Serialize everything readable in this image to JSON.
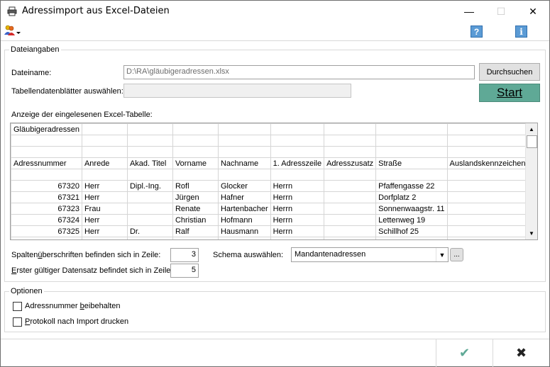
{
  "window": {
    "title": "Adressimport aus Excel-Dateien",
    "minimize": "—",
    "maximize": "☐",
    "close": "✕"
  },
  "toolbar": {
    "people_icon": "people-menu-icon",
    "help_icon": "?",
    "info_icon": "i"
  },
  "dateiangaben": {
    "legend": "Dateiangaben",
    "dateiname_label": "Dateiname:",
    "dateiname_value": "D:\\RA\\gläubigeradressen.xlsx",
    "durchsuchen": "Durchsuchen",
    "tabellenblaetter_label": "Tabellendatenblätter auswählen:",
    "tabellenblaetter_value": "",
    "start": "Start",
    "anzeige_label": "Anzeige der eingelesenen Excel-Tabelle:",
    "grid": {
      "rows": [
        [
          "Gläubigeradressen",
          "",
          "",
          "",
          "",
          "",
          "",
          "",
          ""
        ],
        [
          "",
          "",
          "",
          "",
          "",
          "",
          "",
          "",
          ""
        ],
        [
          "",
          "",
          "",
          "",
          "",
          "",
          "",
          "",
          ""
        ],
        [
          "Adressnummer",
          "Anrede",
          "Akad. Titel",
          "Vorname",
          "Nachname",
          "1. Adresszeile",
          "Adresszusatz",
          "Straße",
          "Auslandskennzeichen"
        ],
        [
          "",
          "",
          "",
          "",
          "",
          "",
          "",
          "",
          ""
        ],
        [
          "67320",
          "Herr",
          "Dipl.-Ing.",
          "Rofl",
          "Glocker",
          "Herrn",
          "",
          "Pfaffengasse 22",
          ""
        ],
        [
          "67321",
          "Herr",
          "",
          "Jürgen",
          "Hafner",
          "Herrn",
          "",
          "Dorfplatz 2",
          ""
        ],
        [
          "67323",
          "Frau",
          "",
          "Renate",
          "Hartenbacher",
          "Herrn",
          "",
          "Sonnenwaagstr. 11",
          ""
        ],
        [
          "67324",
          "Herr",
          "",
          "Christian",
          "Hofmann",
          "Herrn",
          "",
          "Lettenweg 19",
          ""
        ],
        [
          "67325",
          "Herr",
          "Dr.",
          "Ralf",
          "Hausmann",
          "Herrn",
          "",
          "Schillhof 25",
          ""
        ],
        [
          "",
          "",
          "",
          "",
          "",
          "",
          "",
          "",
          ""
        ]
      ]
    },
    "spaltenueberschriften_label_pre": "Spalten",
    "spaltenueberschriften_label_u": "ü",
    "spaltenueberschriften_label_post": "berschriften befinden sich in Zeile:",
    "spaltenueberschriften_value": "3",
    "erster_label_u": "E",
    "erster_label_post": "rster gültiger Datensatz befindet sich in Zeile:",
    "erster_value": "5",
    "schema_label": "Schema auswählen:",
    "schema_value": "Mandantenadressen",
    "schema_more": "..."
  },
  "optionen": {
    "legend": "Optionen",
    "adressnummer_pre": "Adressnummer ",
    "adressnummer_u": "b",
    "adressnummer_post": "eibehalten",
    "protokoll_u": "P",
    "protokoll_post": "rotokoll nach Import drucken"
  },
  "footer": {
    "ok": "✔",
    "cancel": "✖"
  },
  "colors": {
    "start_button": "#5fa996",
    "ok_check": "#5fa996",
    "help_icon": "#5b9bd5"
  }
}
